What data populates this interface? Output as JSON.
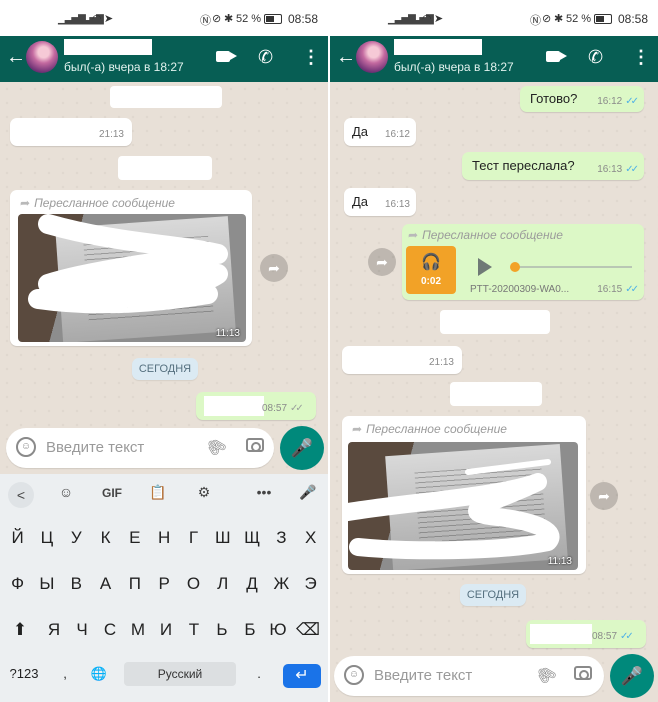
{
  "status_bar": {
    "battery": "52 %",
    "time": "08:58"
  },
  "contact": {
    "last_seen": "был(-а) вчера в 18:27"
  },
  "icons": {
    "back": "arrow-back-icon",
    "video": "video-call-icon",
    "call": "phone-icon",
    "more": "more-vert-icon",
    "forward": "forward-arrow-icon",
    "share": "share-icon",
    "emoji": "emoji-icon",
    "attach": "paperclip-icon",
    "camera": "camera-icon",
    "mic": "mic-icon",
    "headphones": "headphones-icon"
  },
  "colors": {
    "appbar": "#075e54",
    "incoming": "#ffffff",
    "outgoing": "#dcf8c6",
    "accent": "#00897b",
    "read_ticks": "#4fb1e6",
    "audio_accent": "#f2a227"
  },
  "left": {
    "messages": {
      "m1_time": "21:13",
      "forward_label": "Пересланное сообщение",
      "photo_time": "11:13",
      "date": "СЕГОДНЯ",
      "out_time": "08:57"
    },
    "input_placeholder": "Введите текст",
    "keyboard": {
      "toolbar": {
        "back": "<",
        "sticker": "☺",
        "gif": "GIF",
        "clipboard": "📋",
        "settings": "⚙",
        "more": "•••",
        "mic": "🎤"
      },
      "row1": [
        "Й",
        "Ц",
        "У",
        "К",
        "Е",
        "Н",
        "Г",
        "Ш",
        "Щ",
        "З",
        "Х"
      ],
      "row2": [
        "Ф",
        "Ы",
        "В",
        "А",
        "П",
        "Р",
        "О",
        "Л",
        "Д",
        "Ж",
        "Э"
      ],
      "row3": [
        "Я",
        "Ч",
        "С",
        "М",
        "И",
        "Т",
        "Ь",
        "Б",
        "Ю"
      ],
      "shift": "⬆",
      "backspace": "⌫",
      "sym": "?123",
      "comma_emoji": ",",
      "globe": "🌐",
      "space": "Русский",
      "period": ".",
      "enter": "↵"
    }
  },
  "right": {
    "messages": {
      "o1_text": "Готово?",
      "o1_time": "16:12",
      "i1_text": "Да",
      "i1_time": "16:12",
      "o2_text": "Тест переслала?",
      "o2_time": "16:13",
      "i2_text": "Да",
      "i2_time": "16:13",
      "forward_label": "Пересланное сообщение",
      "audio_duration": "0:02",
      "audio_file": "PTT-20200309-WA0...",
      "audio_time": "16:15",
      "m_time": "21:13",
      "photo_time": "11:13",
      "date": "СЕГОДНЯ",
      "out_time": "08:57"
    },
    "input_placeholder": "Введите текст"
  }
}
